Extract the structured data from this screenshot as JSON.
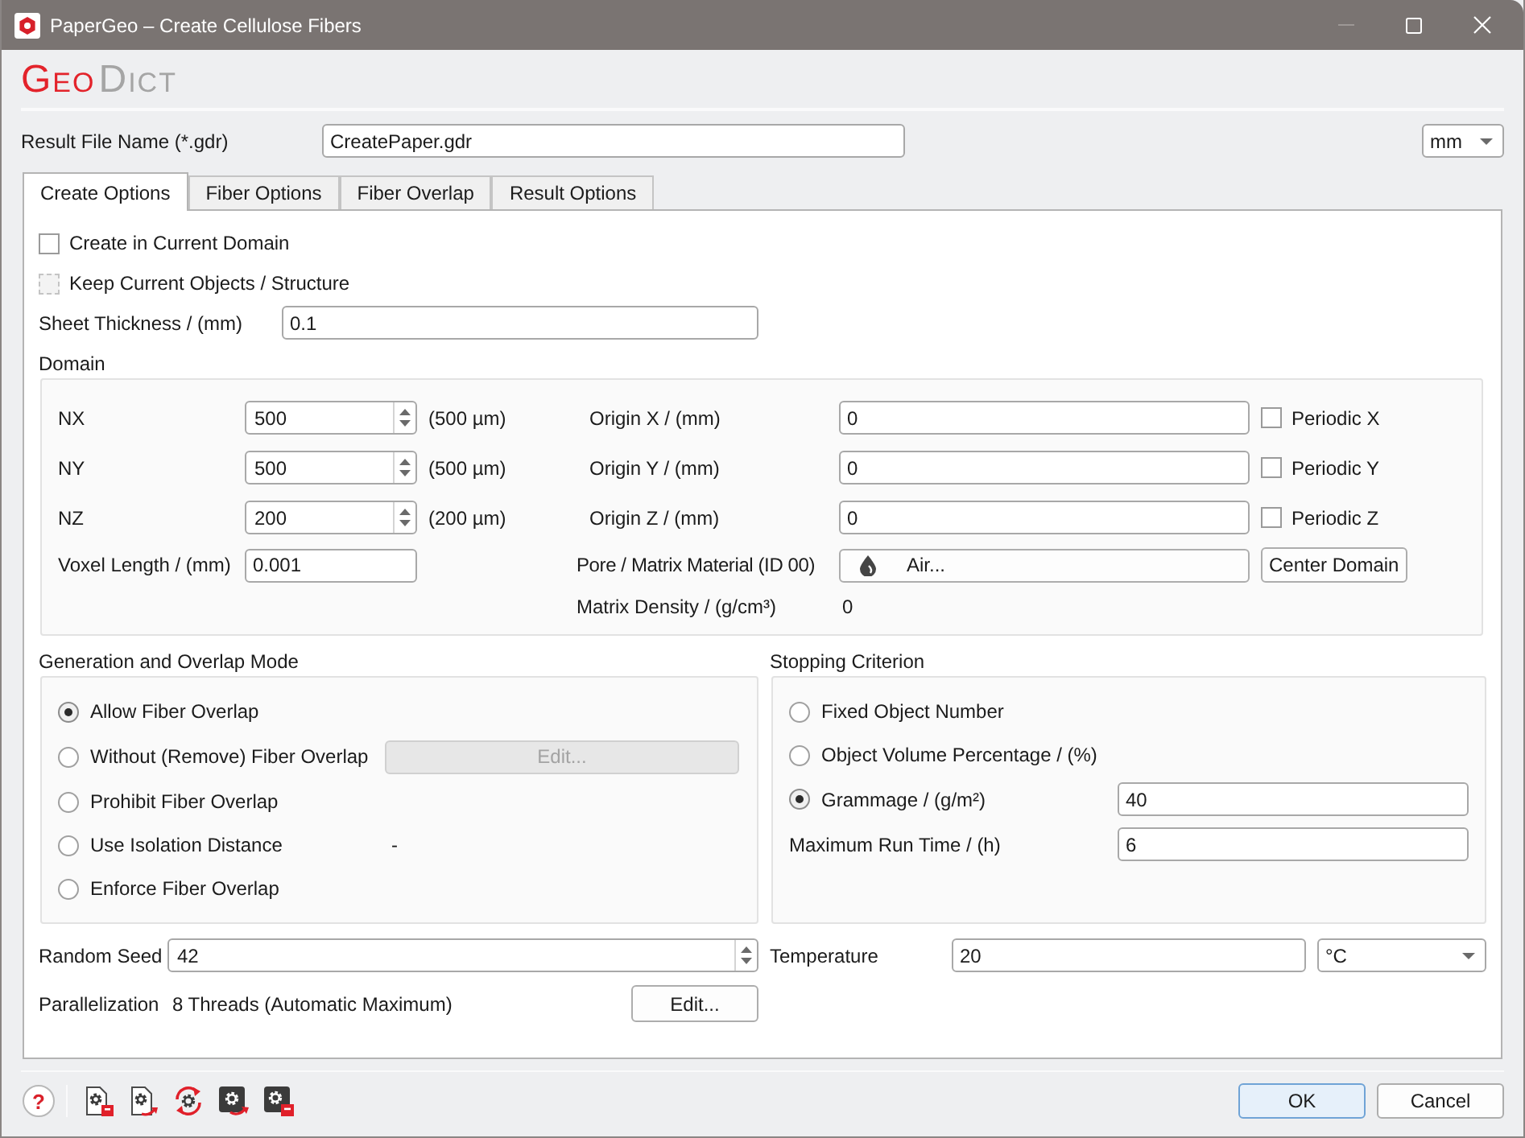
{
  "window": {
    "title": "PaperGeo – Create Cellulose Fibers",
    "controls": [
      {
        "kind": "minimize",
        "disabled": true
      },
      {
        "kind": "maximize",
        "disabled": false
      },
      {
        "kind": "close",
        "disabled": false
      }
    ]
  },
  "logo": [
    "GEO",
    "DICT"
  ],
  "result_file": {
    "label": "Result File Name (*.gdr)",
    "value": "CreatePaper.gdr"
  },
  "length_unit": {
    "value": "mm"
  },
  "tabs": [
    {
      "label": "Create Options",
      "selected": true
    },
    {
      "label": "Fiber Options",
      "selected": false
    },
    {
      "label": "Fiber Overlap",
      "selected": false
    },
    {
      "label": "Result Options",
      "selected": false
    }
  ],
  "options": [
    {
      "label": "Create in Current Domain",
      "checked": false,
      "disabled": false
    },
    {
      "label": "Keep Current Objects / Structure",
      "checked": false,
      "disabled": true
    }
  ],
  "sheet_thickness": {
    "label": "Sheet Thickness / (mm)",
    "value": "0.1"
  },
  "domain": {
    "title": "Domain",
    "rows": [
      {
        "label": "NX",
        "value": "500",
        "extent": "(500 µm)",
        "origin_label": "Origin X / (mm)",
        "origin_value": "0",
        "periodic": {
          "label": "Periodic X",
          "checked": false
        }
      },
      {
        "label": "NY",
        "value": "500",
        "extent": "(500 µm)",
        "origin_label": "Origin Y / (mm)",
        "origin_value": "0",
        "periodic": {
          "label": "Periodic Y",
          "checked": false
        }
      },
      {
        "label": "NZ",
        "value": "200",
        "extent": "(200 µm)",
        "origin_label": "Origin Z / (mm)",
        "origin_value": "0",
        "periodic": {
          "label": "Periodic Z",
          "checked": false
        }
      }
    ],
    "voxel": {
      "label": "Voxel Length / (mm)",
      "value": "0.001"
    },
    "material": {
      "label": "Pore / Matrix Material (ID 00)",
      "value": "Air..."
    },
    "center_button": "Center Domain",
    "density": {
      "label": "Matrix Density / (g/cm³)",
      "value": "0"
    }
  },
  "generation": {
    "title": "Generation and Overlap Mode",
    "modes": [
      {
        "label": "Allow Fiber Overlap",
        "selected": true
      },
      {
        "label": "Without (Remove) Fiber Overlap",
        "selected": false,
        "edit": {
          "label": "Edit...",
          "disabled": true
        }
      },
      {
        "label": "Prohibit Fiber Overlap",
        "selected": false
      },
      {
        "label": "Use Isolation Distance",
        "selected": false,
        "value": "-"
      },
      {
        "label": "Enforce Fiber Overlap",
        "selected": false
      }
    ]
  },
  "stopping": {
    "title": "Stopping Criterion",
    "modes": [
      {
        "label": "Fixed Object Number",
        "selected": false
      },
      {
        "label": "Object Volume Percentage / (%)",
        "selected": false
      },
      {
        "label": "Grammage / (g/m²)",
        "selected": true,
        "value": "40"
      }
    ],
    "max_run_time": {
      "label": "Maximum Run Time / (h)",
      "value": "6"
    }
  },
  "random_seed": {
    "label": "Random Seed",
    "value": "42"
  },
  "temperature": {
    "label": "Temperature",
    "value": "20",
    "unit": "°C"
  },
  "parallelization": {
    "label": "Parallelization",
    "value": "8 Threads (Automatic Maximum)",
    "button": "Edit..."
  },
  "help": "?",
  "buttons": [
    {
      "label": "OK",
      "default": true
    },
    {
      "label": "Cancel",
      "default": false
    }
  ]
}
